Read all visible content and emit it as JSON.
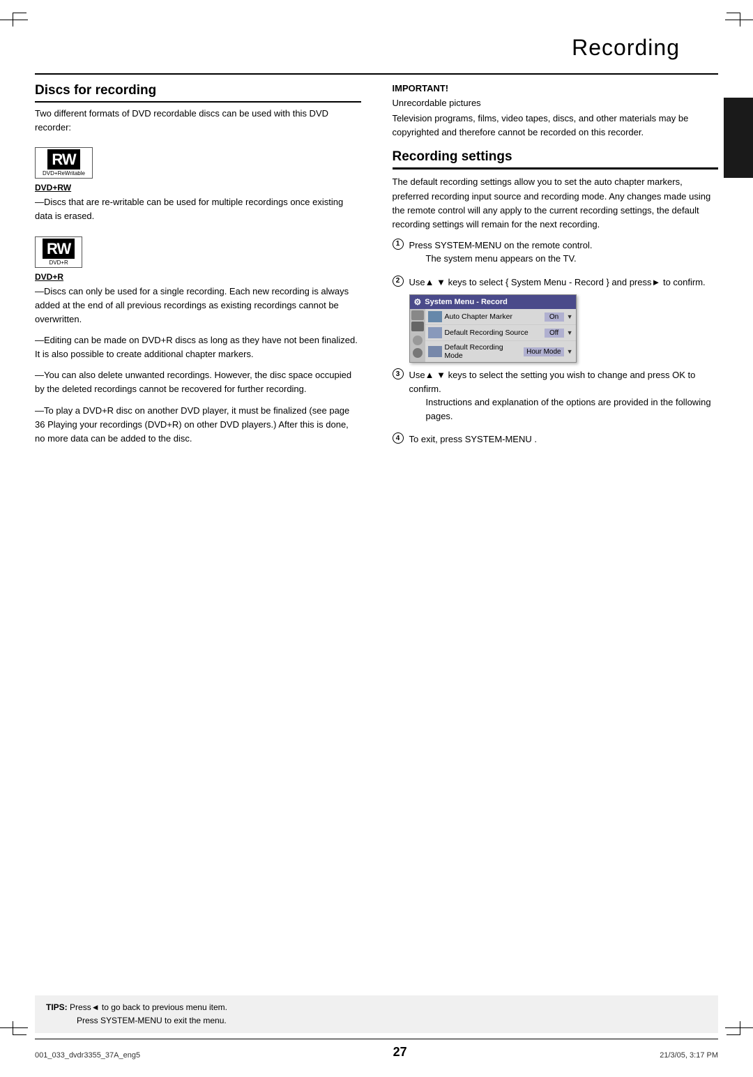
{
  "page": {
    "title": "Recording",
    "page_number": "27",
    "footer_left": "001_033_dvdr3355_37A_eng5",
    "footer_page": "27",
    "footer_right": "21/3/05, 3:17 PM"
  },
  "tips": {
    "label": "TIPS:",
    "line1": "Press◄ to go back to previous menu item.",
    "line2": "Press SYSTEM-MENU  to exit the menu."
  },
  "left_column": {
    "section_title": "Discs for recording",
    "intro": "Two different formats of DVD recordable discs can be used with this DVD recorder:",
    "disc1": {
      "icon_label": "RW",
      "icon_sub": "DVD+ReWritable",
      "label": "DVD+RW",
      "description": "—Discs that are re-writable can be used for multiple recordings once existing data is erased."
    },
    "disc2": {
      "icon_label": "RW",
      "icon_sub": "DVD+R",
      "label": "DVD+R",
      "desc1": "—Discs can only be used for a single recording.  Each new recording is always added at the end of all previous recordings as existing recordings cannot be overwritten.",
      "desc2": "—Editing can be made on DVD+R discs as long as they have not been finalized. It is also possible to create additional chapter markers.",
      "desc3": "—You can also delete unwanted recordings.  However, the disc space occupied by the deleted recordings cannot be recovered for further recording.",
      "desc4": "—To play a DVD+R disc on another DVD player, it must be finalized (see page 36  Playing your recordings (DVD+R) on other DVD players.)  After this is done, no more data can be added to the disc."
    }
  },
  "right_column": {
    "important_label": "IMPORTANT!",
    "important_heading": "Unrecordable pictures",
    "important_text": "Television programs, films, video tapes, discs, and other materials may be copyrighted and therefore cannot be recorded on this recorder.",
    "section_title": "Recording settings",
    "intro": "The default recording settings allow you to set the auto chapter markers, preferred recording input source and recording mode. Any changes made using the remote control will any apply to the current recording settings, the default recording settings will remain for the next recording.",
    "steps": [
      {
        "number": "1",
        "text": "Press SYSTEM-MENU  on the remote control.",
        "indent": "The system menu appears on the TV."
      },
      {
        "number": "2",
        "text": "Use▲ ▼ keys to select     { System Menu - Record } and press► to confirm."
      },
      {
        "number": "3",
        "text": "Use▲ ▼ keys to select the setting you wish to change and press OK  to confirm.",
        "indent": "Instructions and explanation of the options are provided in the following pages."
      },
      {
        "number": "4",
        "text": "To exit, press SYSTEM-MENU ."
      }
    ],
    "menu": {
      "title": "System Menu - Record",
      "rows": [
        {
          "label": "Auto Chapter Marker",
          "value": "On"
        },
        {
          "label": "Default Recording Source",
          "value": "Off"
        },
        {
          "label": "Default Recording Mode",
          "value": "Hour Mode"
        }
      ]
    }
  }
}
